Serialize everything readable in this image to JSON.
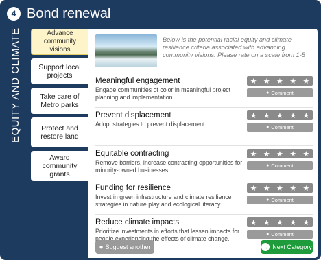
{
  "header": {
    "step": "4",
    "title": "Bond renewal"
  },
  "side_label": "EQUITY AND CLIMATE",
  "nav": {
    "items": [
      {
        "label": "Advance community visions",
        "active": true
      },
      {
        "label": "Support local projects",
        "active": false
      },
      {
        "label": "Take care of Metro parks",
        "active": false
      },
      {
        "label": "Protect and restore land",
        "active": false
      },
      {
        "label": "Award community grants",
        "active": false
      }
    ]
  },
  "intro": {
    "text": "Below is the potential racial equity and climate resilience criteria associated with advancing community visions. Please rate on a scale from 1-5"
  },
  "stars_glyph": "★",
  "comment_label": "Comment",
  "criteria": [
    {
      "title": "Meaningful engagement",
      "description": "Engage communities of color in meaningful project planning and implementation."
    },
    {
      "title": "Prevent displacement",
      "description": "Adopt strategies to prevent displacement."
    },
    {
      "title": "Equitable contracting",
      "description": "Remove barriers, increase contracting opportunities for minority-owned businesses."
    },
    {
      "title": "Funding for resilience",
      "description": "Invest in green infrastructure and climate resilience strategies in nature play and ecological literacy."
    },
    {
      "title": "Reduce climate impacts",
      "description": "Prioritize investments in efforts that lessen impacts for people experiencing the effects of climate change."
    }
  ],
  "footer": {
    "suggest_label": "Suggest another",
    "next_label": "Next Category"
  },
  "colors": {
    "frame": "#1d3a5f",
    "active_tab": "#fdf5c9",
    "stars_bg": "#8a8a8a",
    "next_button": "#1e9b3a"
  }
}
